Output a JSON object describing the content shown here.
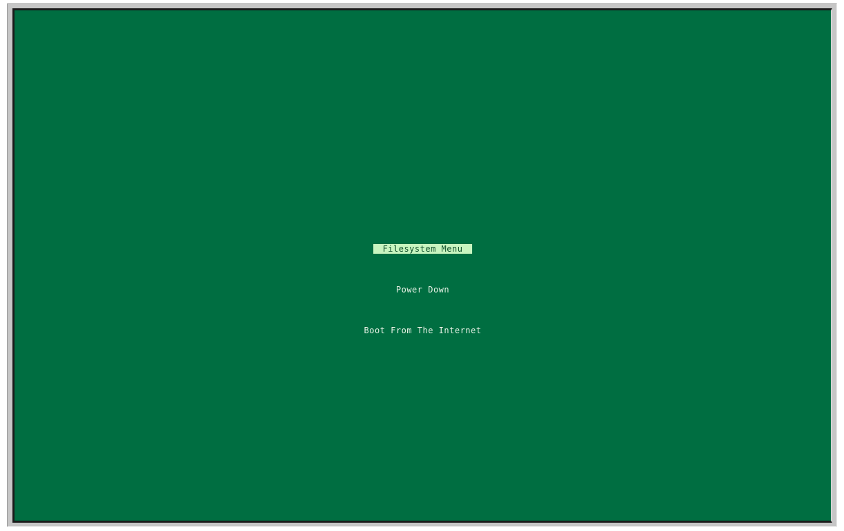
{
  "menu": {
    "items": [
      {
        "label": "Filesystem Menu",
        "selected": true
      },
      {
        "label": "Power Down",
        "selected": false
      },
      {
        "label": "Boot From The Internet",
        "selected": false
      }
    ]
  },
  "colors": {
    "screen_background": "#006e41",
    "text": "#e6f2e6",
    "selection_background": "#c8f5c0",
    "selection_text": "#0e4f2a"
  }
}
